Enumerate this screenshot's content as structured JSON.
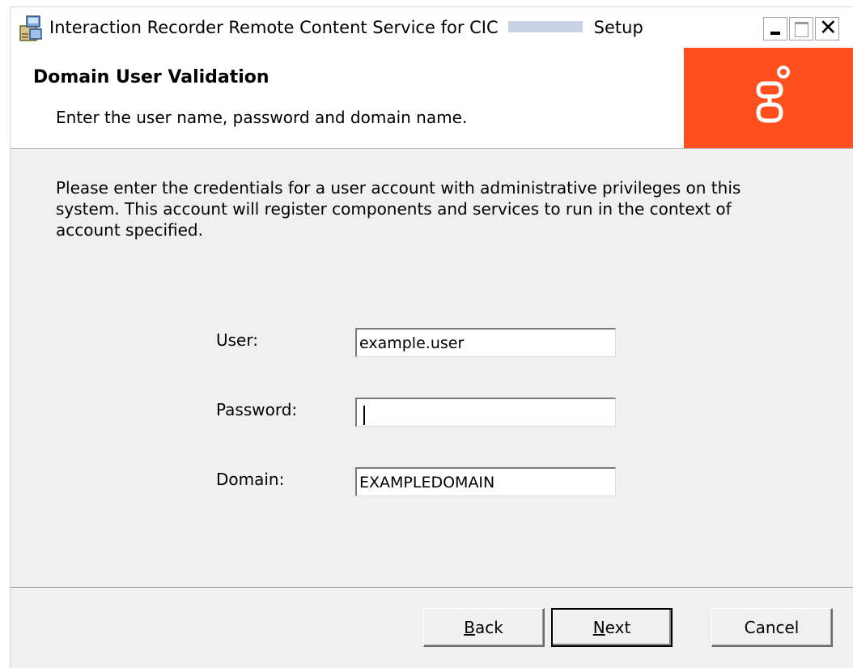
{
  "window": {
    "title_prefix": "Interaction Recorder Remote Content Service for CIC",
    "title_suffix": "Setup"
  },
  "banner": {
    "title": "Domain User Validation",
    "description": "Enter the user name, password and domain name."
  },
  "intro_text": "Please enter the credentials for a user account with administrative privileges on this system.  This account will register components and services to run in the context of account specified.",
  "form": {
    "user_label": "User:",
    "user_value": "example.user",
    "password_label": "Password:",
    "password_value": "",
    "domain_label": "Domain:",
    "domain_value": "EXAMPLEDOMAIN"
  },
  "buttons": {
    "back_mnemonic": "B",
    "back_rest": "ack",
    "next_mnemonic": "N",
    "next_rest": "ext",
    "cancel": "Cancel"
  },
  "colors": {
    "brand": "#ff4f1f",
    "dialog_bg": "#f0f0f0"
  },
  "icons": {
    "app": "installer-icon",
    "logo": "genesys-logo",
    "minimize": "minimize-icon",
    "maximize": "maximize-icon",
    "close": "close-icon"
  }
}
